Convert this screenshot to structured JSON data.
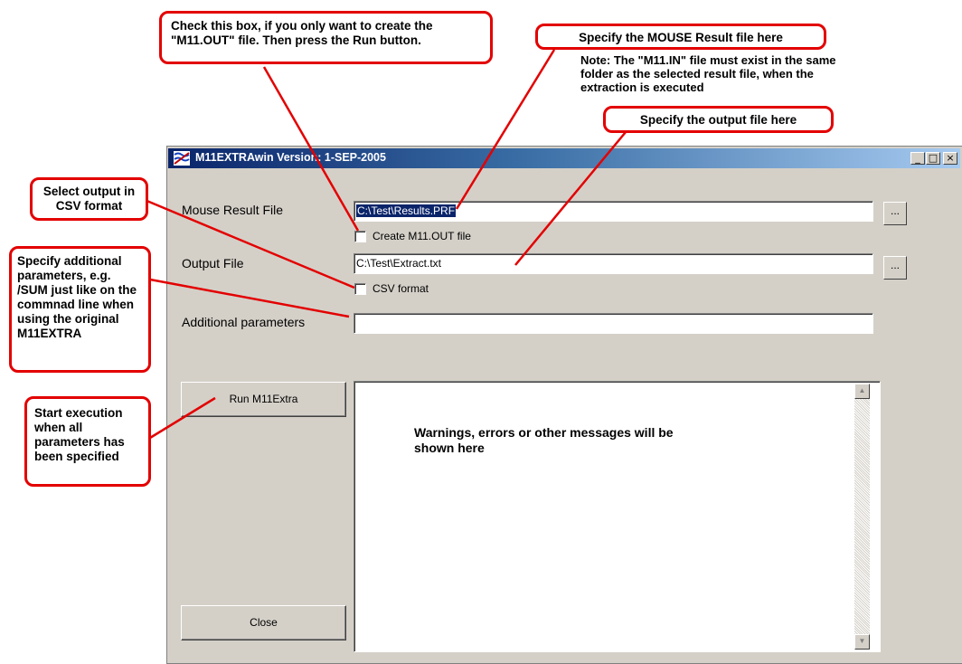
{
  "window": {
    "title": "M11EXTRAwin Version: 1-SEP-2005",
    "caption_buttons": {
      "minimize": "_",
      "maximize": "□",
      "close": "×"
    }
  },
  "form": {
    "mouse_result_label": "Mouse Result File",
    "mouse_result_value": "C:\\Test\\Results.PRF",
    "create_m11_label": "Create M11.OUT file",
    "create_m11_checked": false,
    "output_file_label": "Output File",
    "output_file_value": "C:\\Test\\Extract.txt",
    "csv_label": "CSV format",
    "csv_checked": false,
    "additional_params_label": "Additional parameters",
    "additional_params_value": "",
    "browse_label": "...",
    "run_label": "Run M11Extra",
    "close_label": "Close",
    "messages_text": "Warnings, errors or other messages will be shown here"
  },
  "annotations": {
    "check_box": "Check this box, if you only want to create the \"M11.OUT\" file. Then press the Run button.",
    "mouse_result": "Specify the MOUSE Result file here",
    "note": "Note: The \"M11.IN\" file must exist in the same folder as the selected result file, when the extraction is executed",
    "output": "Specify the output file here",
    "csv": "Select output in CSV format",
    "additional": "Specify additional parameters, e.g. /SUM  just like on the commnad line when using the original M11EXTRA",
    "start": "Start execution when all parameters has been specified"
  },
  "colors": {
    "callout_border": "#e30000",
    "titlebar": "#0a246a",
    "face": "#d4d0c8"
  }
}
